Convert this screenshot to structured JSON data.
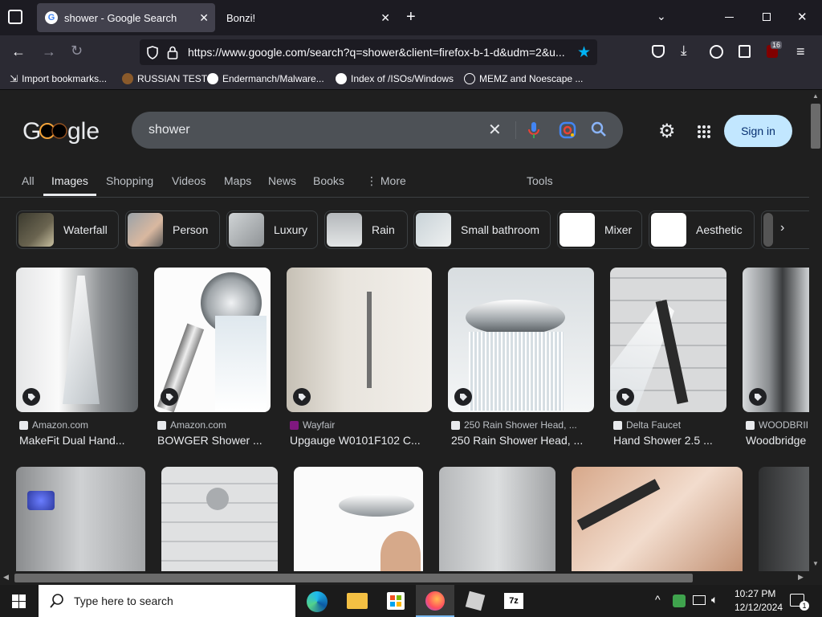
{
  "browser": {
    "tabs": [
      {
        "label": "shower - Google Search",
        "active": true
      },
      {
        "label": "Bonzi!",
        "active": false
      }
    ],
    "url": "https://www.google.com/search?q=shower&client=firefox-b-1-d&udm=2&u...",
    "extension_badge": "16",
    "bookmarks": [
      {
        "label": "Import bookmarks..."
      },
      {
        "label": "RUSSIAN TEST"
      },
      {
        "label": "Endermanch/Malware..."
      },
      {
        "label": "Index of /ISOs/Windows"
      },
      {
        "label": "MEMZ and Noescape ..."
      }
    ]
  },
  "google": {
    "query": "shower",
    "signin": "Sign in",
    "tabs": [
      {
        "label": "All"
      },
      {
        "label": "Images",
        "active": true
      },
      {
        "label": "Shopping"
      },
      {
        "label": "Videos"
      },
      {
        "label": "Maps"
      },
      {
        "label": "News"
      },
      {
        "label": "Books"
      },
      {
        "label": "⋮ More"
      }
    ],
    "tools": "Tools",
    "chips": [
      {
        "label": "Waterfall"
      },
      {
        "label": "Person"
      },
      {
        "label": "Luxury"
      },
      {
        "label": "Rain"
      },
      {
        "label": "Small bathroom"
      },
      {
        "label": "Mixer"
      },
      {
        "label": "Aesthetic"
      }
    ],
    "results_row1": [
      {
        "source": "Amazon.com",
        "title": "MakeFit Dual Hand..."
      },
      {
        "source": "Amazon.com",
        "title": "BOWGER Shower ..."
      },
      {
        "source": "Wayfair",
        "title": "Upgauge W0101F102 C..."
      },
      {
        "source": "250 Rain Shower Head, ...",
        "title": "250 Rain Shower Head, ..."
      },
      {
        "source": "Delta Faucet",
        "title": "Hand Shower 2.5 ..."
      },
      {
        "source": "WOODBRII",
        "title": "Woodbridge"
      }
    ]
  },
  "taskbar": {
    "search_placeholder": "Type here to search",
    "time": "10:27 PM",
    "date": "12/12/2024",
    "notification_count": "1"
  },
  "colors": {
    "page_bg": "#1f1f1f",
    "signin_bg": "#c2e7ff",
    "active_tab_underline": "#e8eaed",
    "taskbar_bg": "#1b1b1b"
  }
}
